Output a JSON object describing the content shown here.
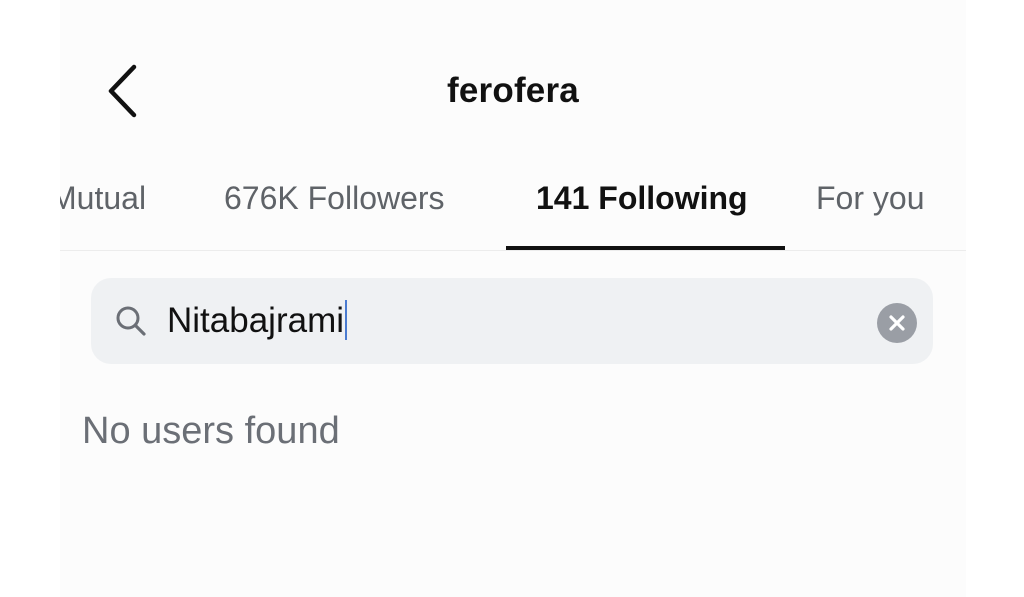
{
  "header": {
    "title": "ferofera",
    "back_icon": "chevron-left-icon"
  },
  "tabs": [
    {
      "label": "Mutual",
      "active": false
    },
    {
      "label": "676K Followers",
      "active": false
    },
    {
      "label": "141 Following",
      "active": true
    },
    {
      "label": "For you",
      "active": false
    }
  ],
  "search": {
    "value": "Nitabajrami",
    "icon": "search-icon",
    "clear_icon": "clear-icon"
  },
  "results": {
    "empty_message": "No users found"
  },
  "colors": {
    "active_tab": "#111111",
    "inactive_tab": "#5f6368",
    "search_background": "#eff1f3",
    "caret": "#4a7bd0"
  }
}
